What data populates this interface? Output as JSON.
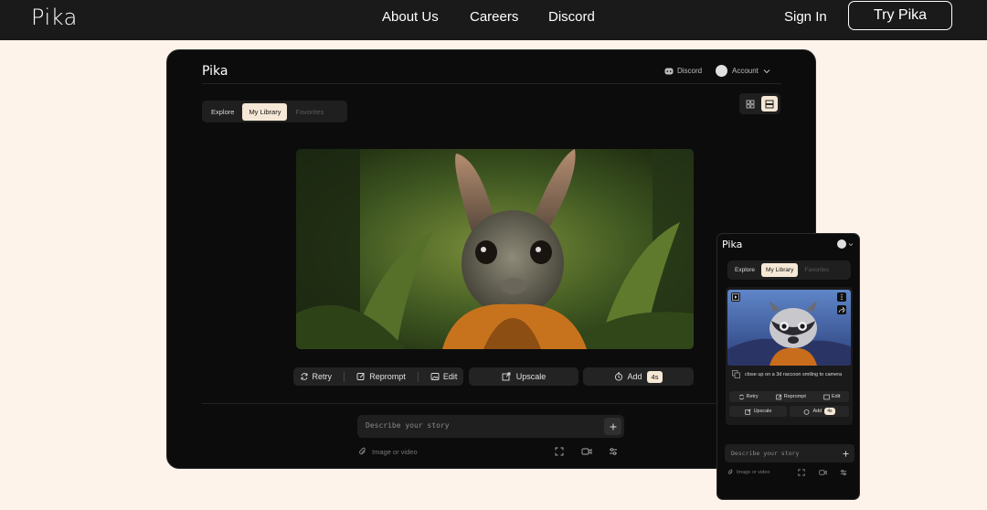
{
  "nav": {
    "brand": "Pika",
    "links": [
      "About Us",
      "Careers",
      "Discord"
    ],
    "sign_in": "Sign In",
    "cta": "Try Pika"
  },
  "desktop": {
    "logo": "Pika",
    "discord_label": "Discord",
    "account_label": "Account",
    "tabs": [
      "Explore",
      "My Library",
      "Favorites"
    ],
    "active_tab": "My Library",
    "actions": {
      "retry": "Retry",
      "reprompt": "Reprompt",
      "edit": "Edit",
      "upscale": "Upscale",
      "add": "Add",
      "add_badge": "4s"
    },
    "prompt_placeholder": "Describe your story",
    "attach_label": "Image or video"
  },
  "mobile": {
    "logo": "Pika",
    "tabs": [
      "Explore",
      "My Library",
      "Favorites"
    ],
    "caption": "close up on a 3d raccoon smiling to camera",
    "actions": {
      "retry": "Retry",
      "reprompt": "Reprompt",
      "edit": "Edit",
      "upscale": "Upscale",
      "add": "Add",
      "add_badge": "4s"
    },
    "prompt_placeholder": "Describe your story",
    "attach_label": "Image or video"
  },
  "colors": {
    "nav_bg": "#1a1a1a",
    "page_bg": "#fdf3eb",
    "app_bg": "#0c0c0c",
    "accent": "#f6e8d6"
  }
}
